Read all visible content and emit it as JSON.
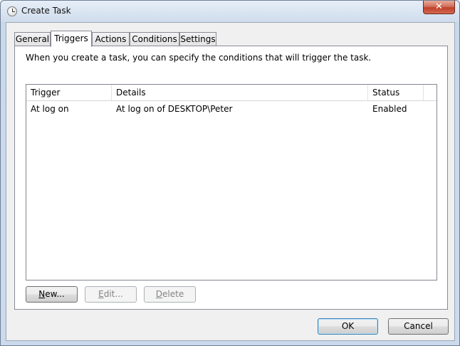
{
  "window": {
    "title": "Create Task",
    "close_label": "✕"
  },
  "tabs": [
    {
      "label": "General",
      "active": false
    },
    {
      "label": "Triggers",
      "active": true
    },
    {
      "label": "Actions",
      "active": false
    },
    {
      "label": "Conditions",
      "active": false
    },
    {
      "label": "Settings",
      "active": false
    }
  ],
  "triggers_page": {
    "description": "When you create a task, you can specify the conditions that will trigger the task.",
    "columns": [
      "Trigger",
      "Details",
      "Status"
    ],
    "rows": [
      {
        "trigger": "At log on",
        "details": "At log on of DESKTOP\\Peter",
        "status": "Enabled"
      }
    ],
    "buttons": {
      "new": {
        "mnemonic": "N",
        "rest": "ew...",
        "enabled": true
      },
      "edit": {
        "mnemonic": "E",
        "rest": "dit...",
        "enabled": false
      },
      "delete": {
        "mnemonic": "D",
        "rest": "elete",
        "enabled": false
      }
    }
  },
  "footer": {
    "ok_label": "OK",
    "cancel_label": "Cancel"
  }
}
